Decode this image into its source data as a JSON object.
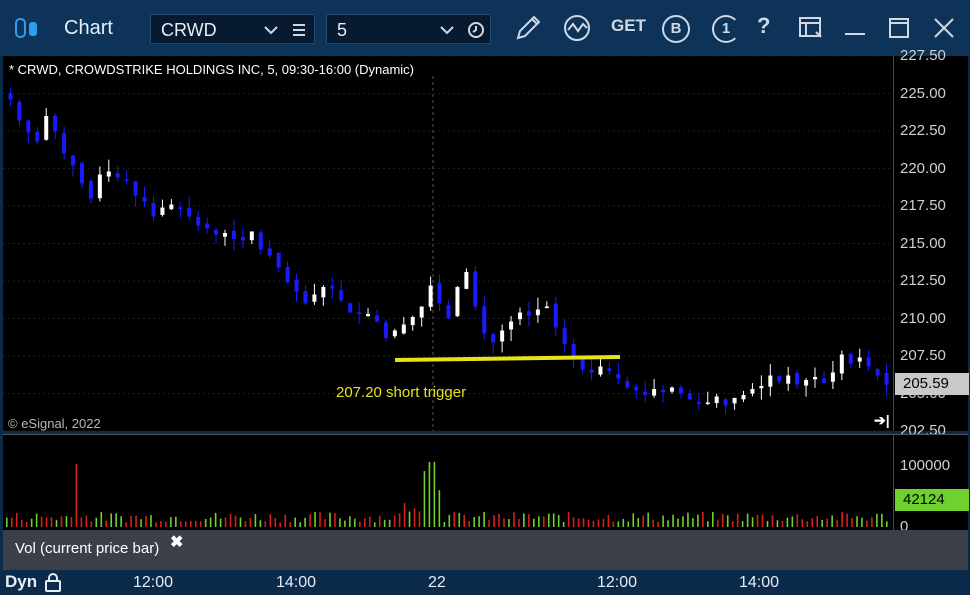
{
  "window": {
    "title": "Chart"
  },
  "toolbar": {
    "symbol_value": "CRWD",
    "interval_value": "5",
    "get_label": "GET",
    "b_label": "B",
    "one_label": "1",
    "help_label": "?"
  },
  "chart": {
    "header": "* CRWD, CROWDSTRIKE HOLDINGS INC, 5, 09:30-16:00 (Dynamic)",
    "copyright": "© eSignal, 2022",
    "annotation": "207.20 short trigger",
    "price_tag": "205.59",
    "price_axis": [
      "227.50",
      "225.00",
      "222.50",
      "220.00",
      "217.50",
      "215.00",
      "212.50",
      "210.00",
      "207.50",
      "205.00",
      "202.50"
    ],
    "volume_axis": [
      "100000",
      "0"
    ],
    "volume_tag": "42124",
    "volume_study_label": "Vol (current price bar)",
    "time_axis": [
      "12:00",
      "14:00",
      "22",
      "12:00",
      "14:00"
    ],
    "mode_label": "Dyn",
    "colors": {
      "up": "#ffffff",
      "down": "#1a1aff",
      "trigger_line": "#e4e41a",
      "vol_up": "#6fd12e",
      "vol_down": "#d62020"
    }
  },
  "chart_data": {
    "type": "candlestick",
    "title": "* CRWD, CROWDSTRIKE HOLDINGS INC, 5, 09:30-16:00 (Dynamic)",
    "ylim": [
      202.5,
      227.5
    ],
    "close_path": [
      224.6,
      223.2,
      222.4,
      221.8,
      223.5,
      222.5,
      221.0,
      220.2,
      219.0,
      218.0,
      219.6,
      219.8,
      219.4,
      219.2,
      218.2,
      217.8,
      216.8,
      217.4,
      217.6,
      217.3,
      216.8,
      216.2,
      216.0,
      215.6,
      215.7,
      215.3,
      215.2,
      215.8,
      214.6,
      214.2,
      213.4,
      212.4,
      211.8,
      211.0,
      211.6,
      212.1,
      212.0,
      211.2,
      210.4,
      210.3,
      210.3,
      209.8,
      208.7,
      209.2,
      209.6,
      210.1,
      210.8,
      212.2,
      211.0,
      210.0,
      212.1,
      213.1,
      210.8,
      209.0,
      208.4,
      209.2,
      209.8,
      210.4,
      210.2,
      210.6,
      210.8,
      209.4,
      208.3,
      207.4,
      206.6,
      206.4,
      206.8,
      206.5,
      206.0,
      205.4,
      205.2,
      204.9,
      205.3,
      205.1,
      205.4,
      205.0,
      204.6,
      204.3,
      204.4,
      204.8,
      204.2,
      204.7,
      204.9,
      205.3,
      205.5,
      206.2,
      205.8,
      206.2,
      205.6,
      205.9,
      206.1,
      205.7,
      206.4,
      207.6,
      207.0,
      207.4,
      206.8,
      206.2,
      205.59
    ],
    "trigger": {
      "label": "207.20 short trigger",
      "price": 207.2
    },
    "volume": {
      "last": 42124,
      "ylim": [
        0,
        120000
      ],
      "spikes_up": [
        420,
        425,
        431,
        436
      ],
      "spike_values": [
        73000,
        85000,
        85000,
        48000
      ],
      "spike_down_at": 75,
      "spike_down_value": 82000
    }
  }
}
